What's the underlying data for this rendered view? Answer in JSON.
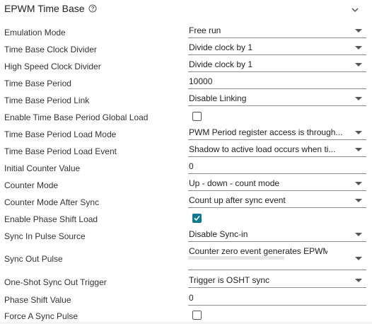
{
  "panel": {
    "title": "EPWM Time Base",
    "help_icon": "help-circle-icon",
    "collapse_icon": "chevron-down-icon"
  },
  "fields": {
    "emulation_mode": {
      "label": "Emulation Mode",
      "value": "Free run"
    },
    "tb_clock_divider": {
      "label": "Time Base Clock Divider",
      "value": "Divide clock by 1"
    },
    "hs_clock_divider": {
      "label": "High Speed Clock Divider",
      "value": "Divide clock by 1"
    },
    "tb_period": {
      "label": "Time Base Period",
      "value": "10000"
    },
    "tb_period_link": {
      "label": "Time Base Period Link",
      "value": "Disable Linking"
    },
    "tb_period_global_load": {
      "label": "Enable Time Base Period Global Load",
      "checked": false
    },
    "tb_period_load_mode": {
      "label": "Time Base Period Load Mode",
      "value": "PWM Period register access is through..."
    },
    "tb_period_load_event": {
      "label": "Time Base Period Load Event",
      "value": "Shadow to active load occurs when ti..."
    },
    "initial_counter": {
      "label": "Initial Counter Value",
      "value": "0"
    },
    "counter_mode": {
      "label": "Counter Mode",
      "value": "Up - down - count mode"
    },
    "counter_mode_after_sync": {
      "label": "Counter Mode After Sync",
      "value": "Count up after sync event"
    },
    "phase_shift_load": {
      "label": "Enable Phase Shift Load",
      "checked": true
    },
    "sync_in_source": {
      "label": "Sync In Pulse Source",
      "value": "Disable Sync-in"
    },
    "sync_out_pulse": {
      "label": "Sync Out Pulse",
      "value": "Counter zero event generates EPWM"
    },
    "one_shot_sync_out": {
      "label": "One-Shot Sync Out Trigger",
      "value": "Trigger is OSHT sync"
    },
    "phase_shift_value": {
      "label": "Phase Shift Value",
      "value": "0"
    },
    "force_sync_pulse": {
      "label": "Force A Sync Pulse",
      "checked": false
    }
  },
  "colors": {
    "checkbox_checked": "#0e7a8c",
    "underline": "#8f8f8f"
  }
}
